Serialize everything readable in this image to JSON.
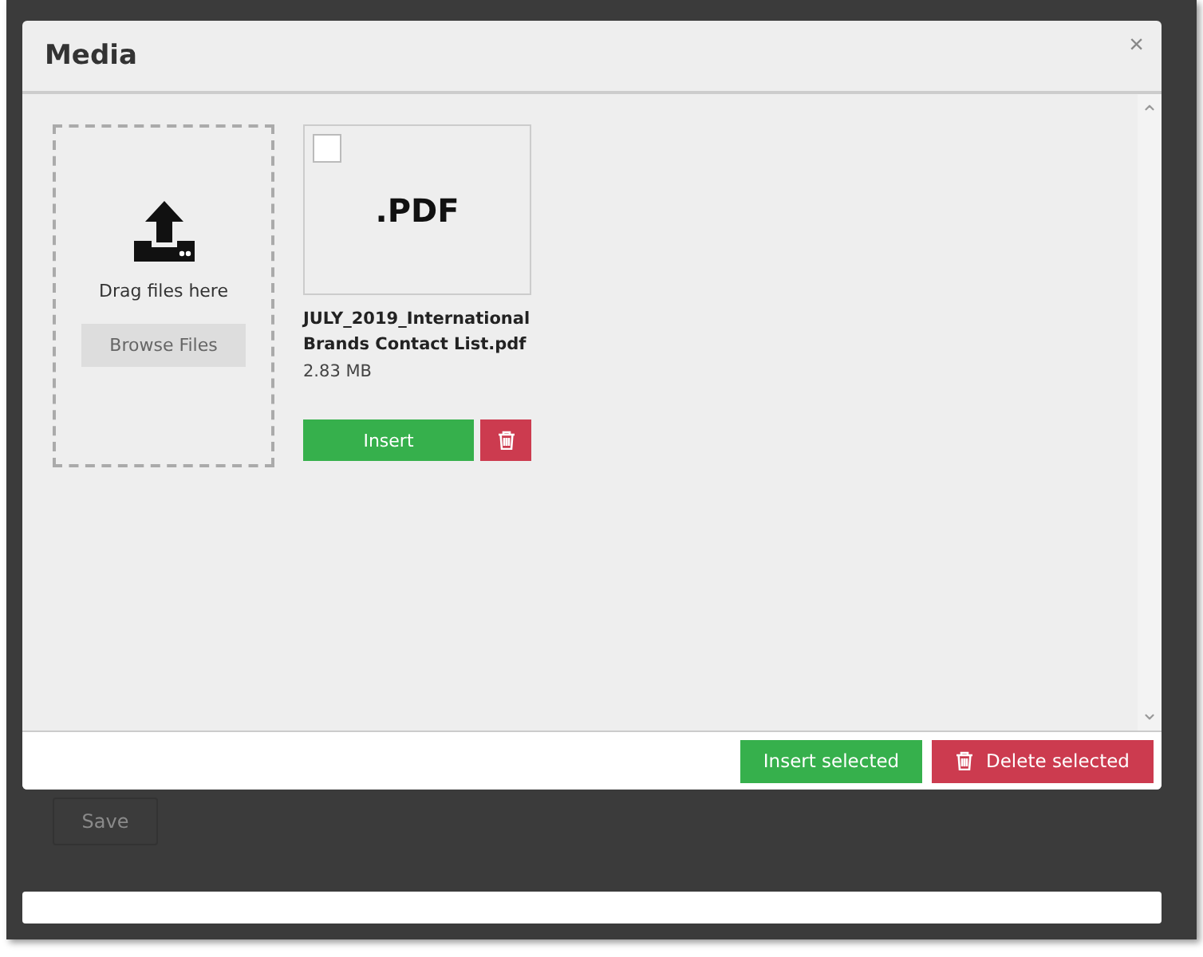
{
  "dialog": {
    "title": "Media",
    "close": "×"
  },
  "dropzone": {
    "text": "Drag files here",
    "button": "Browse Files"
  },
  "files": [
    {
      "type": ".PDF",
      "name": "JULY_2019_International Brands Contact List.pdf",
      "size": "2.83 MB",
      "checked": false,
      "insert": "Insert"
    }
  ],
  "footer": {
    "insert_selected": "Insert selected",
    "delete_selected": "Delete selected"
  },
  "background": {
    "save": "Save"
  }
}
